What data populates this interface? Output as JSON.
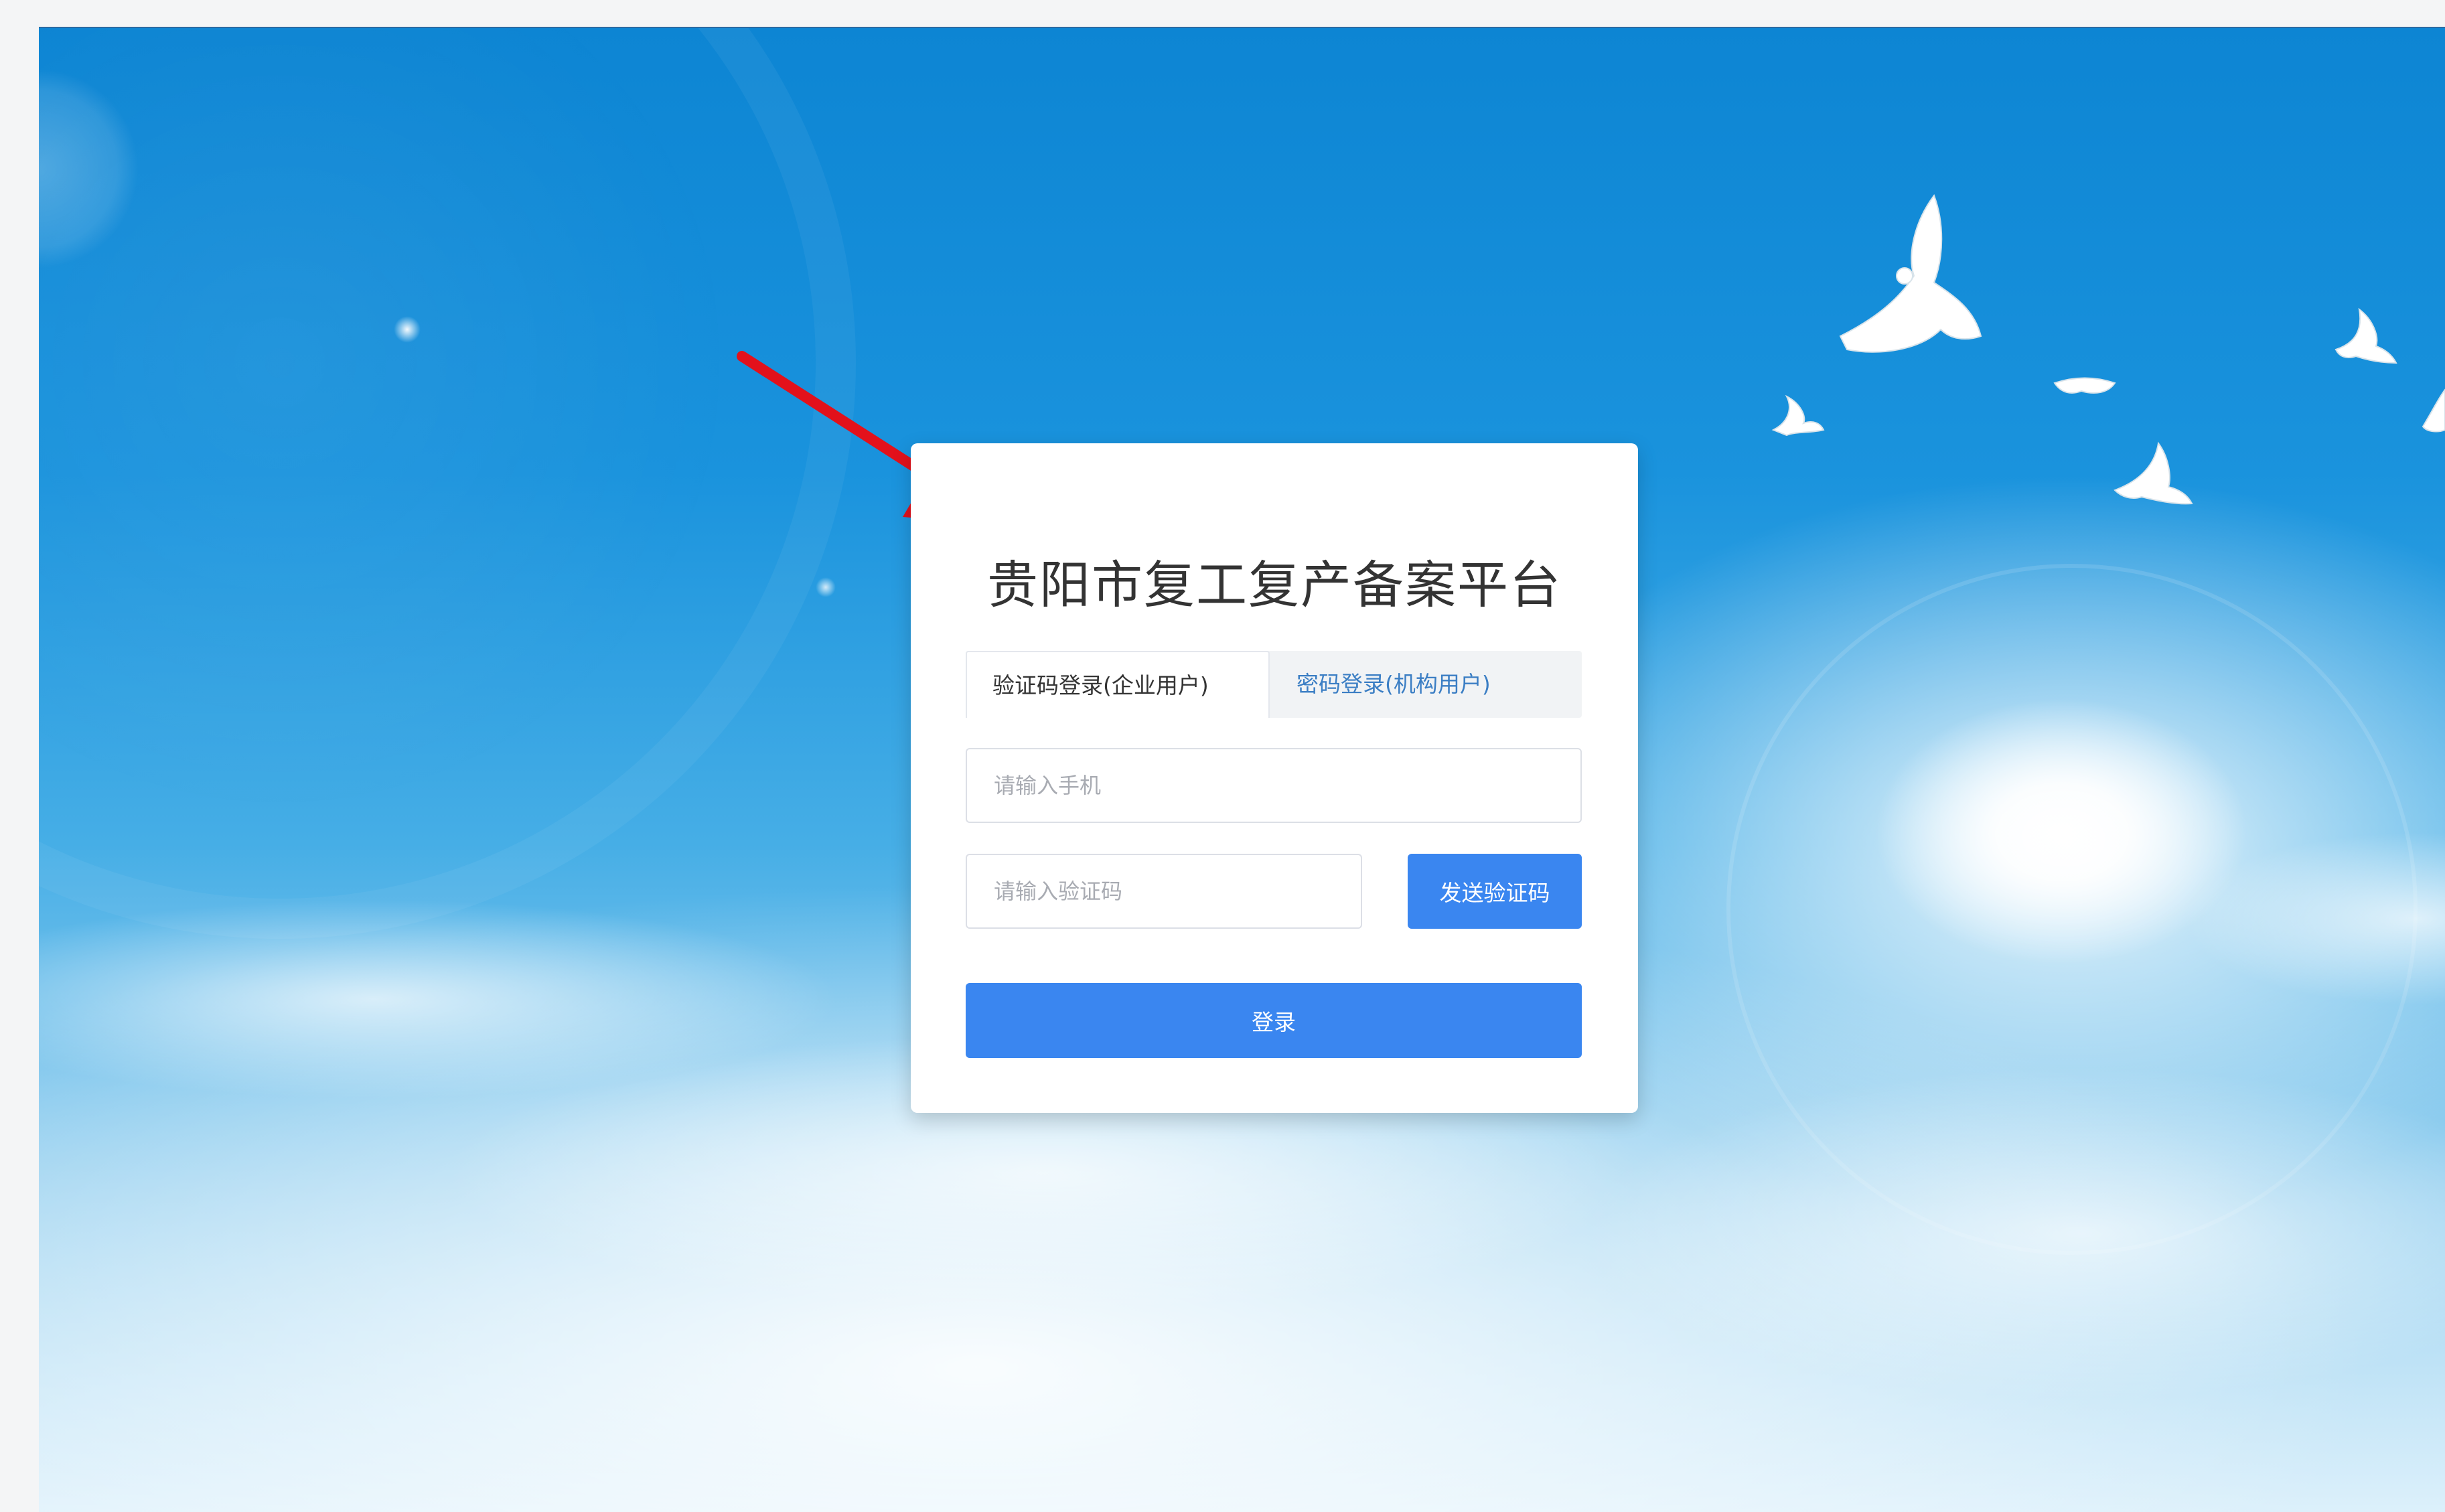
{
  "login": {
    "title": "贵阳市复工复产备案平台",
    "tabs": [
      {
        "label": "验证码登录(企业用户)",
        "active": true
      },
      {
        "label": "密码登录(机构用户)",
        "active": false
      }
    ],
    "phone_placeholder": "请输入手机",
    "code_placeholder": "请输入验证码",
    "send_code_label": "发送验证码",
    "submit_label": "登录"
  },
  "icons": {
    "annotation": "red-arrow-icon",
    "background_decor": "flying-doves"
  },
  "colors": {
    "primary_button": "#3a86f0",
    "inactive_tab_text": "#3b7ec4",
    "sky_top": "#0d85d3",
    "annotation_arrow": "#e3111b"
  }
}
